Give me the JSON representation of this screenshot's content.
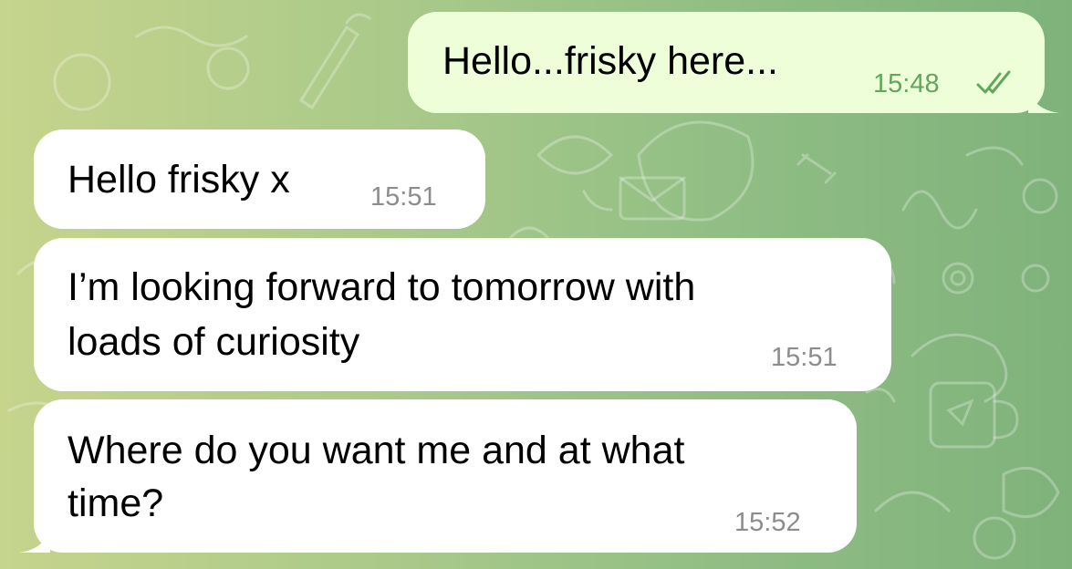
{
  "messages": [
    {
      "direction": "outgoing",
      "lines": [
        "Hello...frisky here..."
      ],
      "time": "15:48",
      "read": true
    },
    {
      "direction": "incoming",
      "lines": [
        "Hello frisky x"
      ],
      "time": "15:51"
    },
    {
      "direction": "incoming",
      "lines": [
        "I’m looking forward to tomorrow with",
        "loads of curiosity"
      ],
      "time": "15:51"
    },
    {
      "direction": "incoming",
      "lines": [
        "Where do you want me and at what",
        "time?"
      ],
      "time": "15:52"
    }
  ],
  "colors": {
    "incoming_bubble": "#ffffff",
    "outgoing_bubble": "#eefed8",
    "read_ticks": "#5fa85a",
    "timestamp": "#8c8c8c"
  },
  "icons": {
    "read_receipt": "double-check-icon",
    "background": "doodle-pattern"
  }
}
